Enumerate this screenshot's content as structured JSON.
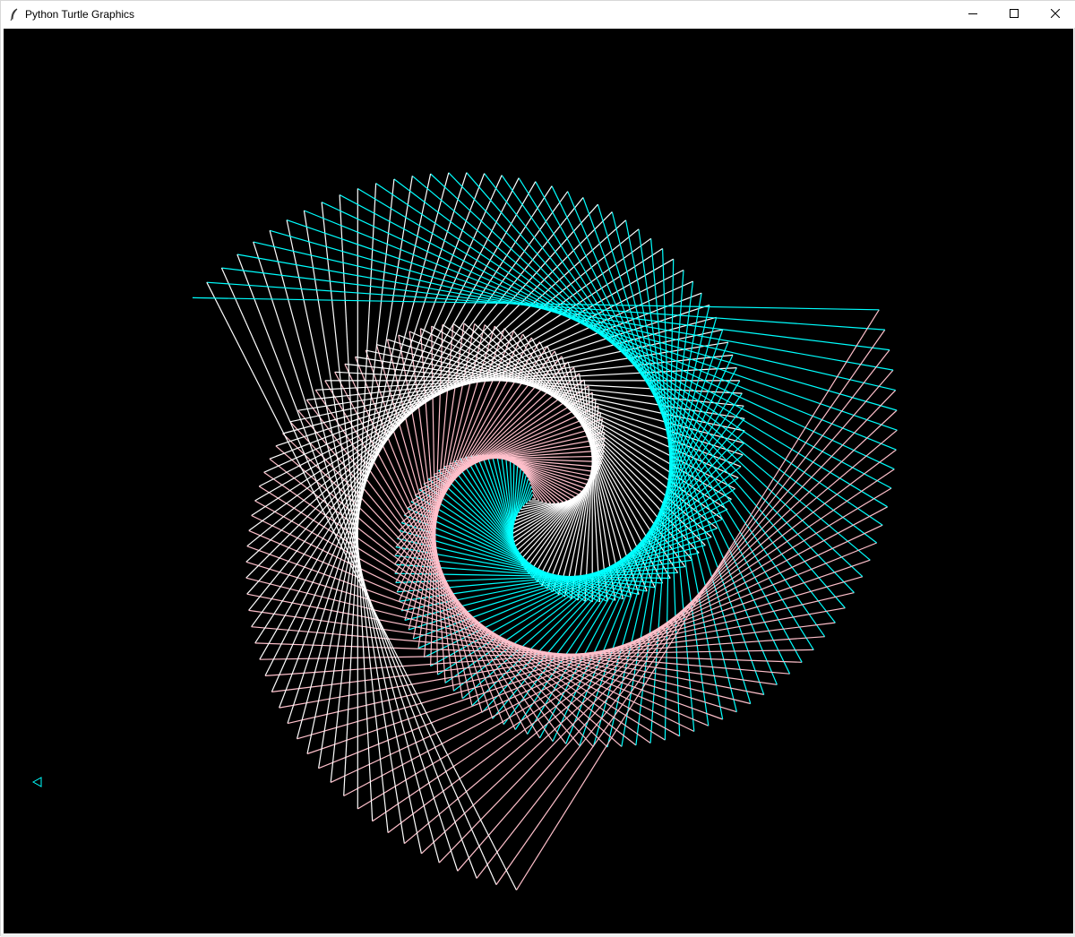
{
  "window": {
    "title": "Python Turtle Graphics",
    "app_icon": "feather-icon",
    "controls": {
      "minimize_icon": "minimize-icon",
      "maximize_icon": "maximize-icon",
      "close_icon": "close-icon"
    }
  },
  "canvas": {
    "background_color": "#000000",
    "pen_colors": [
      "#ffffff",
      "#ffc0cb",
      "#00ffff"
    ],
    "turtle_icon": "turtle-arrow-icon"
  }
}
